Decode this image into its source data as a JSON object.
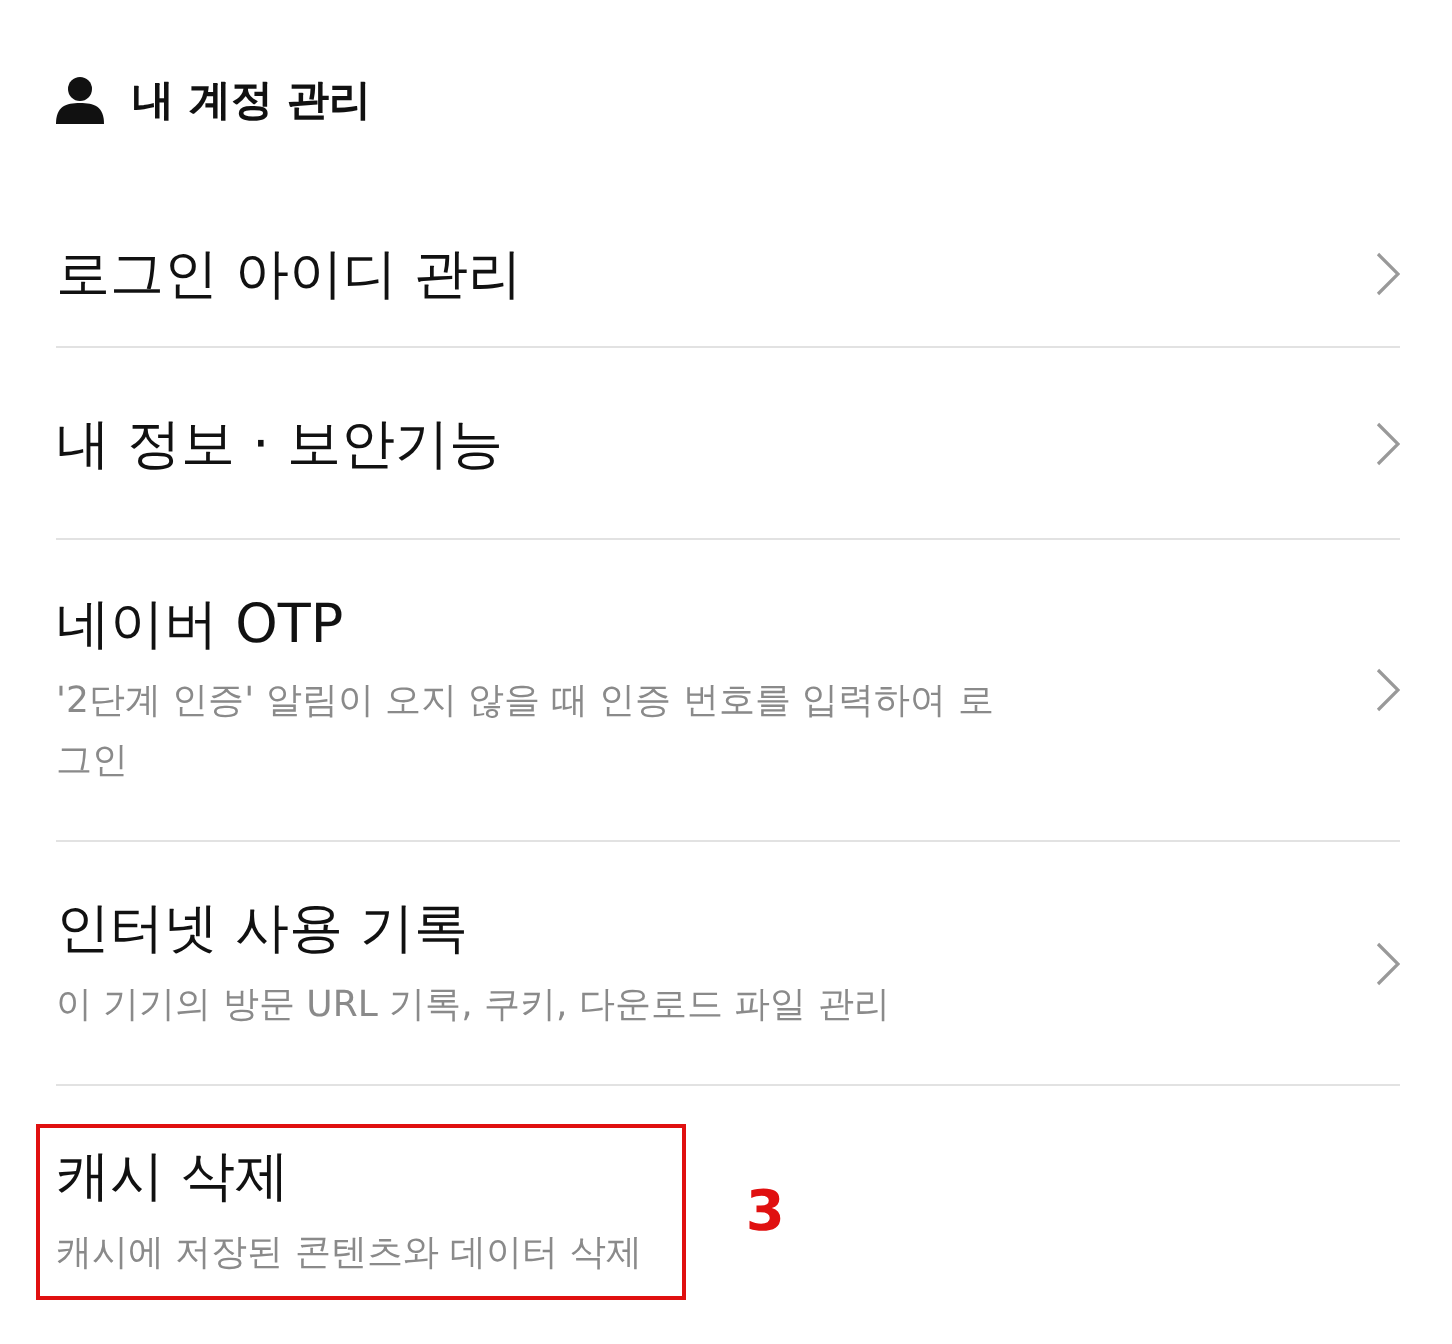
{
  "header": {
    "title": "내 계정 관리"
  },
  "items": [
    {
      "title": "로그인 아이디 관리",
      "chevron": true,
      "marked": false
    },
    {
      "title": "내 정보 · 보안기능",
      "chevron": true,
      "marked": false
    },
    {
      "title": "네이버 OTP",
      "subtitle": "'2단계 인증' 알림이 오지 않을 때 인증 번호를 입력하여 로그인",
      "chevron": true,
      "marked": false
    },
    {
      "title": "인터넷 사용 기록",
      "subtitle": "이 기기의 방문 URL 기록, 쿠키, 다운로드 파일 관리",
      "chevron": true,
      "marked": false
    },
    {
      "title": "캐시 삭제",
      "subtitle": "캐시에 저장된 콘텐츠와 데이터 삭제",
      "chevron": false,
      "marked": true,
      "annotation": "3"
    }
  ]
}
